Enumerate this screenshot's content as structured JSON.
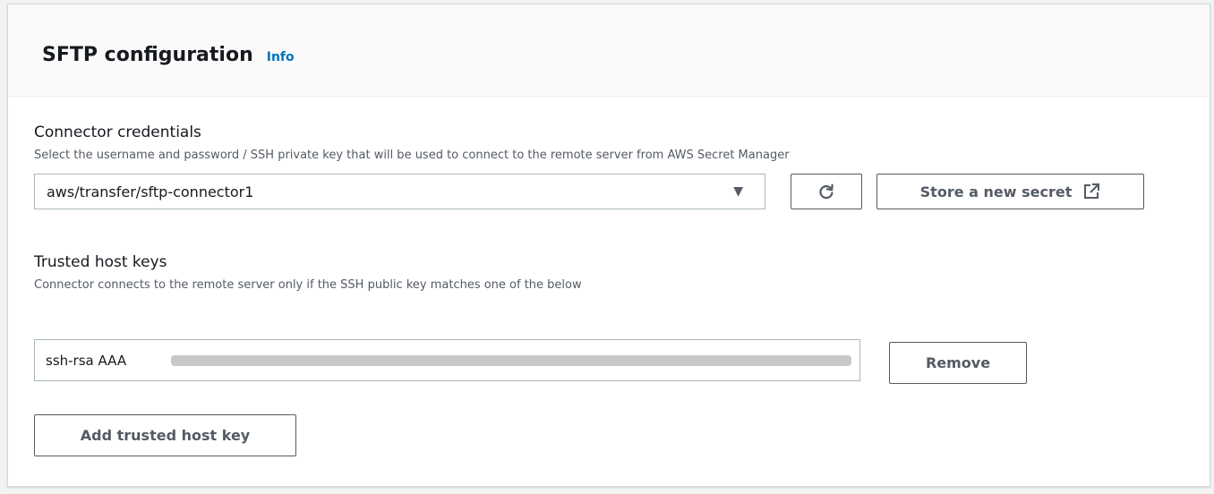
{
  "panel": {
    "title": "SFTP configuration",
    "info_label": "Info"
  },
  "credentials": {
    "label": "Connector credentials",
    "description": "Select the username and password / SSH private key that will be used to connect to the remote server from AWS Secret Manager",
    "selected_value": "aws/transfer/sftp-connector1",
    "refresh_icon": "refresh-icon",
    "store_button_label": "Store a new secret",
    "store_button_icon": "external-link-icon"
  },
  "trusted_keys": {
    "label": "Trusted host keys",
    "description": "Connector connects to the remote server only if the SSH public key matches one of the below",
    "keys": [
      {
        "value": "ssh-rsa AAA"
      }
    ],
    "remove_label": "Remove",
    "add_label": "Add trusted host key"
  },
  "colors": {
    "link": "#0073bb",
    "button_text": "#545b64",
    "border": "#aab7b8",
    "header_bg": "#fafafa"
  }
}
